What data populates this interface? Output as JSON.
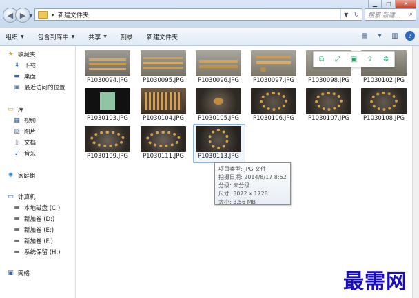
{
  "address": {
    "crumb": "新建文件夹"
  },
  "search": {
    "placeholder": "搜索 新建..."
  },
  "toolbar": {
    "organize": "组织",
    "include_library": "包含到库中",
    "share": "共享",
    "burn": "刻录",
    "new_folder": "新建文件夹"
  },
  "sidebar": {
    "favorites": "收藏夹",
    "downloads": "下载",
    "desktop": "桌面",
    "recent": "最近访问的位置",
    "libraries": "库",
    "videos": "视频",
    "pictures": "图片",
    "documents": "文档",
    "music": "音乐",
    "homegroup": "家庭组",
    "computer": "计算机",
    "drive_c": "本地磁盘 (C:)",
    "drive_d": "新加卷 (D:)",
    "drive_e": "新加卷 (E:)",
    "drive_f": "新加卷 (F:)",
    "drive_h": "系统保留 (H:)",
    "network": "网络"
  },
  "files": [
    "P1030094.JPG",
    "P1030095.JPG",
    "P1030096.JPG",
    "P1030097.JPG",
    "P1030098.JPG",
    "P1030102.JPG",
    "P1030103.JPG",
    "P1030104.JPG",
    "P1030105.JPG",
    "P1030106.JPG",
    "P1030107.JPG",
    "P1030108.JPG",
    "P1030109.JPG",
    "P1030111.JPG",
    "P1030113.JPG"
  ],
  "tooltip": {
    "type": "项目类型: JPG 文件",
    "date": "拍摄日期: 2014/8/17 8:52",
    "rating": "分级: 未分级",
    "dimensions": "尺寸: 3072 x 1728",
    "size": "大小: 3.56 MB"
  },
  "watermark": "最需网",
  "colors": {
    "accent": "#1a0dbd",
    "toolbar": "#e0e9f5",
    "selection": "#8fb4de"
  }
}
